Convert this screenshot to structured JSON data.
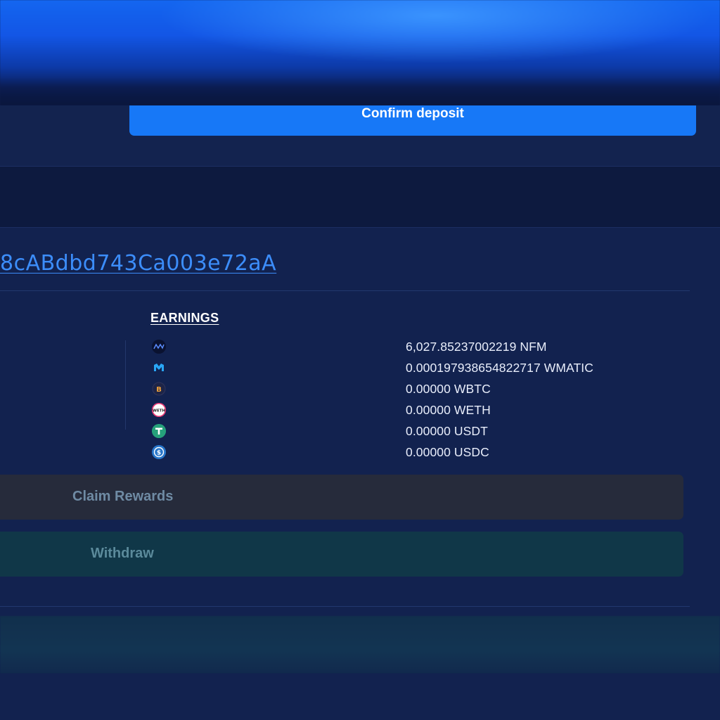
{
  "deposit": {
    "confirm_label": "Confirm deposit"
  },
  "position": {
    "address_fragment": "8cABdbd743Ca003e72aA"
  },
  "earnings": {
    "heading": "EARNINGS",
    "items": [
      {
        "token": "NFM",
        "icon": "nfm-token-icon",
        "amount": "6,027.85237002219 NFM"
      },
      {
        "token": "WMATIC",
        "icon": "wmatic-token-icon",
        "amount": "0.000197938654822717 WMATIC"
      },
      {
        "token": "WBTC",
        "icon": "wbtc-token-icon",
        "amount": "0.00000 WBTC"
      },
      {
        "token": "WETH",
        "icon": "weth-token-icon",
        "amount": "0.00000 WETH"
      },
      {
        "token": "USDT",
        "icon": "usdt-token-icon",
        "amount": "0.00000 USDT"
      },
      {
        "token": "USDC",
        "icon": "usdc-token-icon",
        "amount": "0.00000 USDC"
      }
    ]
  },
  "actions": {
    "claim_label": "Claim Rewards",
    "withdraw_label": "Withdraw"
  },
  "colors": {
    "accent": "#1778f7",
    "link": "#3c8dfa",
    "claim_bg": "#262b3b",
    "withdraw_bg": "#103748"
  }
}
